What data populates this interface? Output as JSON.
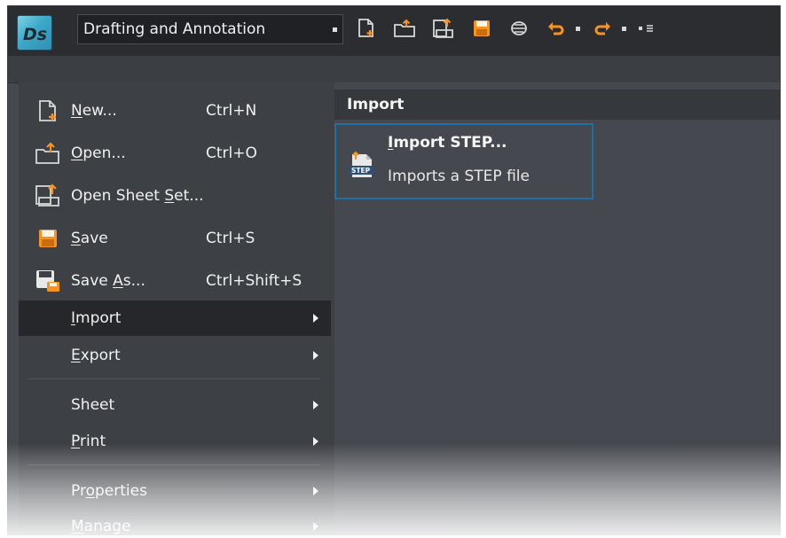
{
  "titlebar": {
    "logo_text": "Ds",
    "workspace_value": "Drafting and Annotation",
    "quick_access": [
      {
        "icon": "new-file-icon"
      },
      {
        "icon": "open-folder-icon"
      },
      {
        "icon": "open-sheet-set-icon"
      },
      {
        "icon": "save-icon"
      },
      {
        "icon": "print-icon"
      },
      {
        "icon": "undo-icon"
      },
      {
        "icon": "redo-icon"
      },
      {
        "icon": "customize-dropdown-icon"
      }
    ],
    "accent_color": "#f7931e"
  },
  "menu": {
    "items": [
      {
        "label_pre": "",
        "label_u": "N",
        "label_post": "ew...",
        "shortcut": "Ctrl+N",
        "icon": "new-file-icon"
      },
      {
        "label_pre": "",
        "label_u": "O",
        "label_post": "pen...",
        "shortcut": "Ctrl+O",
        "icon": "open-folder-icon"
      },
      {
        "label_pre": "Open Sheet ",
        "label_u": "S",
        "label_post": "et...",
        "shortcut": "",
        "icon": "open-sheet-set-icon"
      },
      {
        "label_pre": "",
        "label_u": "S",
        "label_post": "ave",
        "shortcut": "Ctrl+S",
        "icon": "save-icon"
      },
      {
        "label_pre": "Save ",
        "label_u": "A",
        "label_post": "s...",
        "shortcut": "Ctrl+Shift+S",
        "icon": "save-as-icon"
      },
      {
        "label_pre": "",
        "label_u": "I",
        "label_post": "mport",
        "shortcut": "",
        "icon": "",
        "submenu": true,
        "active": true
      },
      {
        "label_pre": "",
        "label_u": "E",
        "label_post": "xport",
        "shortcut": "",
        "icon": "",
        "submenu": true
      },
      {
        "label_pre": "Sheet",
        "label_u": "",
        "label_post": "",
        "shortcut": "",
        "icon": "",
        "submenu": true
      },
      {
        "label_pre": "",
        "label_u": "P",
        "label_post": "rint",
        "shortcut": "",
        "icon": "",
        "submenu": true
      },
      {
        "label_pre": "Pr",
        "label_u": "o",
        "label_post": "perties",
        "shortcut": "",
        "icon": "",
        "submenu": true
      },
      {
        "label_pre": "",
        "label_u": "M",
        "label_post": "anage",
        "shortcut": "",
        "icon": "",
        "submenu": true
      }
    ]
  },
  "panel": {
    "header": "Import",
    "card": {
      "title_u": "I",
      "title_rest": "mport STEP...",
      "description": "Imports a STEP file",
      "icon": "step-file-icon",
      "icon_text": "STEP"
    },
    "highlight_color": "#1f6fa3"
  }
}
